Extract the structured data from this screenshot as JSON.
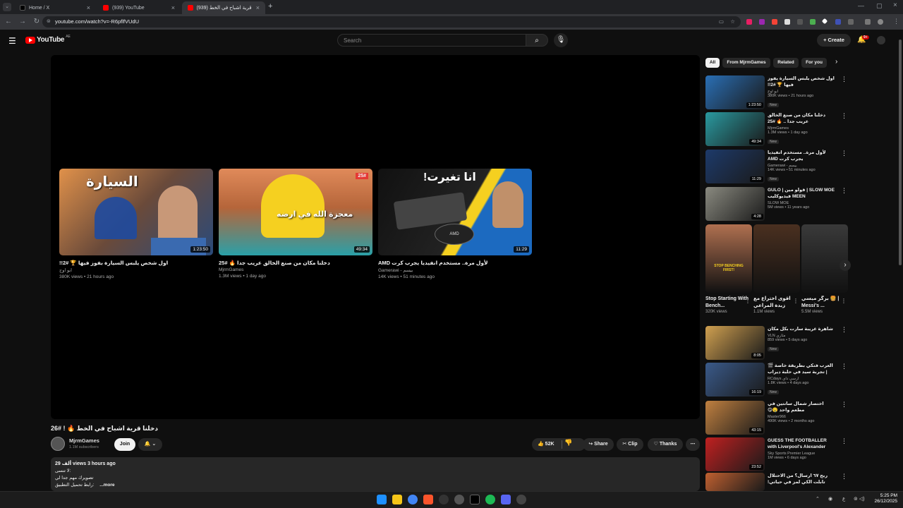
{
  "browser": {
    "tabs": [
      {
        "title": "Home / X",
        "favicon_color": "#000000"
      },
      {
        "title": "(939) YouTube",
        "favicon_color": "#ff0000"
      },
      {
        "title": "(939) دخلنا قرية اشباح في الخط",
        "favicon_color": "#ff0000"
      }
    ],
    "url": "youtube.com/watch?v=-R6pflfVUdU",
    "new_tab_glyph": "+"
  },
  "youtube": {
    "logo": "YouTube",
    "region": "AE",
    "search_placeholder": "Search",
    "create_label": "Create",
    "notif_badge": "9+"
  },
  "endscreen": [
    {
      "title": "اول شخص يلبس السيارة بفوز فيها 🏆 #2!!",
      "channel": "ابو اوج",
      "meta": "380K views • 21 hours ago",
      "duration": "1:23:50",
      "thumb_text": "السيارة",
      "thumb_bg": "#c97a3a"
    },
    {
      "title": "دخلنا مكان من صنع الخالق عريب جدا 🔥 #25",
      "channel": "MjrmGames",
      "meta": "1.3M views • 1 day ago",
      "duration": "49:34",
      "thumb_text": "معجزة الله في ارضه",
      "thumb_bg": "#b5653a"
    },
    {
      "title": "لأول مرة.. مستخدم انفيديا يجرب كرت AMD",
      "channel": "Gamerawi - بيسم",
      "meta": "14K views • 51 minutes ago",
      "duration": "11:29",
      "thumb_text": "انا تغيرت!",
      "thumb_bg": "#1a1a2e"
    }
  ],
  "video": {
    "title": "دخلنا قرية اشباح في الخط 🔥 ! #26",
    "channel": "MjrmGames",
    "subs": "1.1M subscribers",
    "join_label": "Join",
    "likes": "52K",
    "share_label": "Share",
    "clip_label": "Clip",
    "thanks_label": "Thanks",
    "desc_views": "29 ألف views  3 hours ago",
    "desc_line1": "لا تنسى:",
    "desc_line2": "تصويرك مهم جدا لي",
    "desc_line3": "رابط تحميل التطبيق:",
    "desc_more": "...more"
  },
  "chips": [
    "All",
    "From MjrmGames",
    "Related",
    "For you"
  ],
  "sidebar": [
    {
      "title": "اول شخص يلبس السيارة يفوز فيها 🏆 #2!!",
      "channel": "ابو اوج",
      "meta": "380K views • 21 hours ago",
      "badge": "New",
      "duration": "1:23:50",
      "bg": "#2a6fb5"
    },
    {
      "title": "دخلنا مكان من صنع الخالق عريب جدا .. 🔥 #25",
      "channel": "MjrmGames",
      "meta": "1.3M views • 1 day ago",
      "badge": "New",
      "duration": "49:34",
      "bg": "#2a9aa0"
    },
    {
      "title": "لأول مرة.. مستخدم انفيديا يجرب كرت AMD",
      "channel": "Gamerawi - بيسم",
      "meta": "14K views • 51 minutes ago",
      "badge": "New",
      "duration": "11:29",
      "bg": "#1d3a6a"
    },
    {
      "title": "SLOW MOE | قولو مين | GULO MEEN فيديوكليب",
      "channel": "SLOW MOE",
      "meta": "5M views • 11 years ago",
      "badge": "",
      "duration": "4:28",
      "bg": "#8a8a80"
    },
    {
      "title": "شاهرة غريبة سارت بكل مكان",
      "channel": "VLN مثاري",
      "meta": "859 views • 5 days ago",
      "badge": "New",
      "duration": "8:05",
      "bg": "#d0a050"
    },
    {
      "title": "العرب فتكي بطريقة خاصة 🎬 | تجربة سيد في حلبة ديراب السيارات الاشكالية",
      "channel": "RCdays ارسي داي",
      "meta": "1.8K views • 4 days ago",
      "badge": "New",
      "duration": "16:19",
      "bg": "#3a5a8a"
    },
    {
      "title": "اختصار شمال سانتين في مطعم واحد 🤤😋",
      "channel": "Master966",
      "meta": "490K views • 2 months ago",
      "badge": "",
      "duration": "43:15",
      "bg": "#c08040"
    },
    {
      "title": "GUESS THE FOOTBALLER with Liverpool's Alexander Isak & ...",
      "channel": "Sky Sports Premier League",
      "meta": "1M views • 6 days ago",
      "badge": "",
      "duration": "23:52",
      "bg": "#c02020"
    },
    {
      "title": "ربح ٦٧ ارسال؟ من الاحتلال تابلت الكي لمز في حياتي!",
      "channel": "",
      "meta": "",
      "badge": "",
      "duration": "",
      "bg": "#c06030"
    }
  ],
  "shorts": [
    {
      "title": "Stop Starting With Bench...",
      "views": "320K views",
      "bg": "#b07050",
      "overlay": "STOP BENCHING FIRST!"
    },
    {
      "title": "اقوى اختراع مع زبدة المراعي",
      "views": "1.1M views",
      "bg": "#4a3020",
      "overlay": ""
    },
    {
      "title": "برگر ميسي 🍔 | Messi's ...",
      "views": "5.5M views",
      "bg": "#3a3a3a",
      "overlay": ""
    }
  ],
  "taskbar": {
    "time": "5:25 PM",
    "date": "26/12/2025",
    "lang": "ع"
  }
}
